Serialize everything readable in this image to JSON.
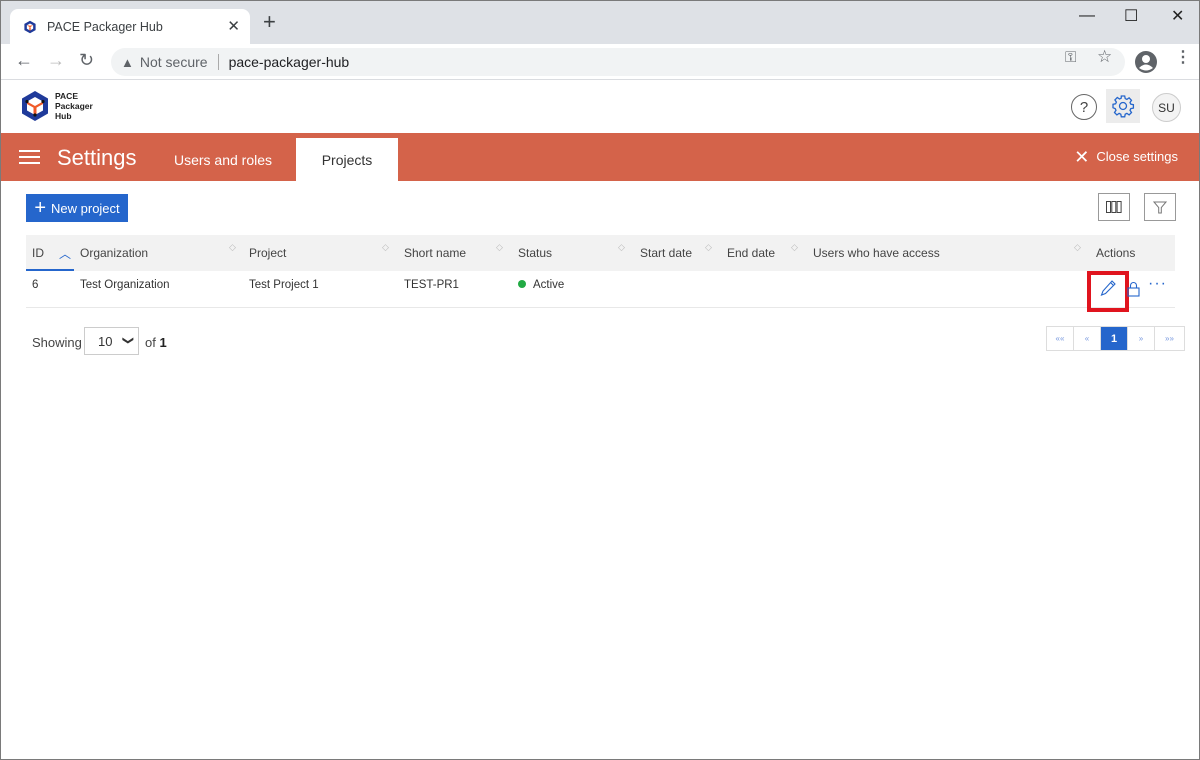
{
  "browser": {
    "tab_title": "PACE Packager Hub",
    "new_tab": "+",
    "security_label": "Not secure",
    "url": "pace-packager-hub"
  },
  "app": {
    "logo_lines": [
      "PACE",
      "Packager",
      "Hub"
    ],
    "help_label": "?",
    "user_initials": "SU"
  },
  "settings": {
    "title": "Settings",
    "tabs": [
      {
        "label": "Users and roles",
        "active": false
      },
      {
        "label": "Projects",
        "active": true
      }
    ],
    "close_label": "Close settings"
  },
  "toolbar": {
    "new_project_label": "New project"
  },
  "table": {
    "columns": [
      "ID",
      "Organization",
      "Project",
      "Short name",
      "Status",
      "Start date",
      "End date",
      "Users who have access",
      "Actions"
    ],
    "sorted_by": "ID",
    "sort_direction": "ascending",
    "rows": [
      {
        "id": "6",
        "organization": "Test Organization",
        "project": "Test Project 1",
        "short_name": "TEST-PR1",
        "status": "Active",
        "start_date": "",
        "end_date": "",
        "users": ""
      }
    ]
  },
  "pagination": {
    "showing_label": "Showing",
    "page_size": "10",
    "of_label": "of",
    "total_pages": "1",
    "current_page": "1",
    "first": "««",
    "prev": "«",
    "next": "»",
    "last": "»»"
  },
  "colors": {
    "accent": "#2566cc",
    "settings_bar": "#d4634a",
    "status_active": "#22aa44",
    "highlight": "#e0141e"
  }
}
